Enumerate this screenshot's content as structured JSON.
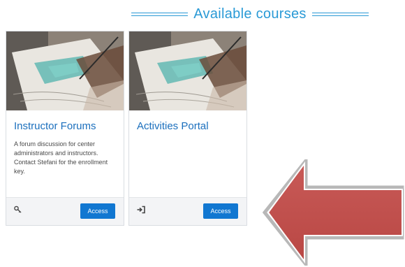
{
  "section": {
    "title": "Available courses"
  },
  "courses": [
    {
      "title": "Instructor Forums",
      "description": "A forum discussion for center administrators and instructors.  Contact Stefani for the enrollment key.",
      "footer_icon": "key-icon",
      "access_label": "Access"
    },
    {
      "title": "Activities Portal",
      "description": "",
      "footer_icon": "sign-in-icon",
      "access_label": "Access"
    }
  ],
  "annotation": {
    "arrow_icon": "left-arrow-icon",
    "arrow_color": "#c0504d"
  },
  "colors": {
    "accent": "#2a9ad6",
    "title": "#1b6fbd",
    "button": "#1177d1"
  }
}
